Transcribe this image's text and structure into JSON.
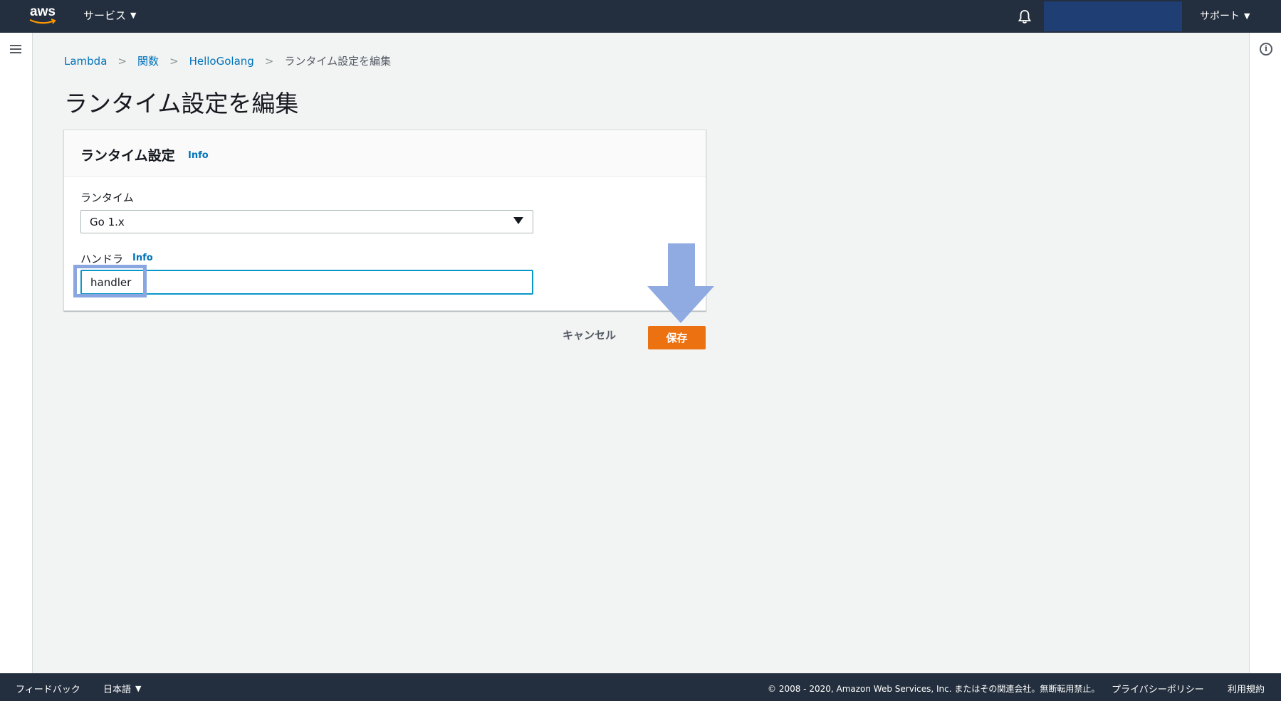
{
  "topnav": {
    "logo_text": "aws",
    "services_label": "サービス",
    "support_label": "サポート",
    "icons": [
      "aws-logo-icon",
      "bell-icon",
      "chevron-down-icon"
    ]
  },
  "breadcrumb": {
    "items": [
      "Lambda",
      "関数",
      "HelloGolang"
    ],
    "current": "ランタイム設定を編集"
  },
  "page": {
    "title": "ランタイム設定を編集"
  },
  "panel": {
    "title": "ランタイム設定",
    "info_label": "Info",
    "runtime_label": "ランタイム",
    "runtime_value": "Go 1.x",
    "handler_label": "ハンドラ",
    "handler_info_label": "Info",
    "handler_value": "handler"
  },
  "actions": {
    "cancel_label": "キャンセル",
    "save_label": "保存"
  },
  "footer": {
    "feedback": "フィードバック",
    "language": "日本語",
    "copyright": "© 2008 - 2020, Amazon Web Services, Inc. またはその関連会社。無断転用禁止。",
    "privacy": "プライバシーポリシー",
    "terms": "利用規約"
  },
  "colors": {
    "nav_bg": "#232f3e",
    "link": "#0073bb",
    "primary_button": "#ec7211",
    "focus_border": "#0a97c9",
    "annotation": "#8aa6e0"
  }
}
